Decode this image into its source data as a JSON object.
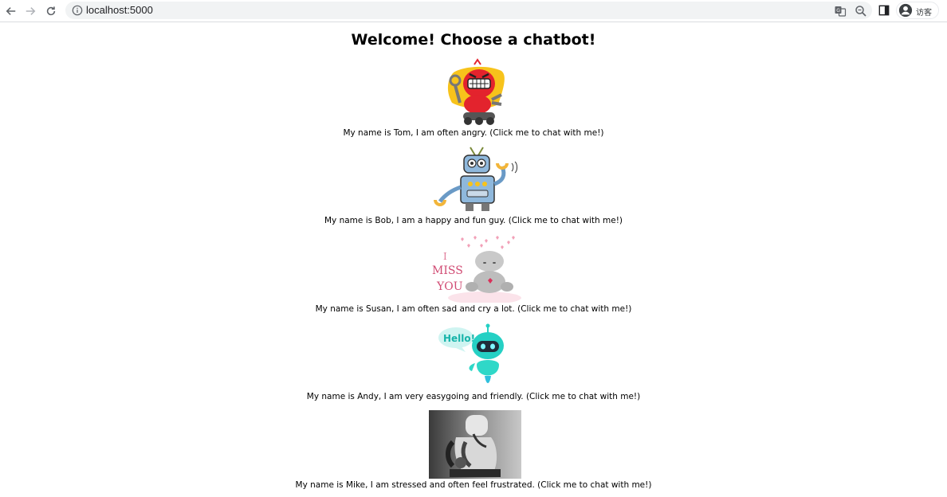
{
  "browser": {
    "url": "localhost:5000",
    "profile_label": "访客"
  },
  "page": {
    "title": "Welcome! Choose a chatbot!",
    "bots": [
      {
        "name": "Tom",
        "caption": "My name is Tom, I am often angry. (Click me to chat with me!)"
      },
      {
        "name": "Bob",
        "caption": "My name is Bob, I am a happy and fun guy. (Click me to chat with me!)"
      },
      {
        "name": "Susan",
        "caption": "My name is Susan, I am often sad and cry a lot. (Click me to chat with me!)",
        "image_text": [
          "I",
          "MISS",
          "YOU"
        ]
      },
      {
        "name": "Andy",
        "caption": "My name is Andy, I am very easygoing and friendly. (Click me to chat with me!)",
        "image_text": [
          "Hello!"
        ]
      },
      {
        "name": "Mike",
        "caption": "My name is Mike, I am stressed and often feel frustrated. (Click me to chat with me!)"
      }
    ]
  },
  "colors": {
    "toolbar_bg": "#ffffff",
    "omnibox_bg": "#f1f3f4",
    "tom_red": "#e3232d",
    "tom_yellow": "#f7c31b",
    "bob_blue": "#8fb8dc",
    "susan_pink": "#f2a1b8",
    "andy_teal": "#25d0c4"
  }
}
